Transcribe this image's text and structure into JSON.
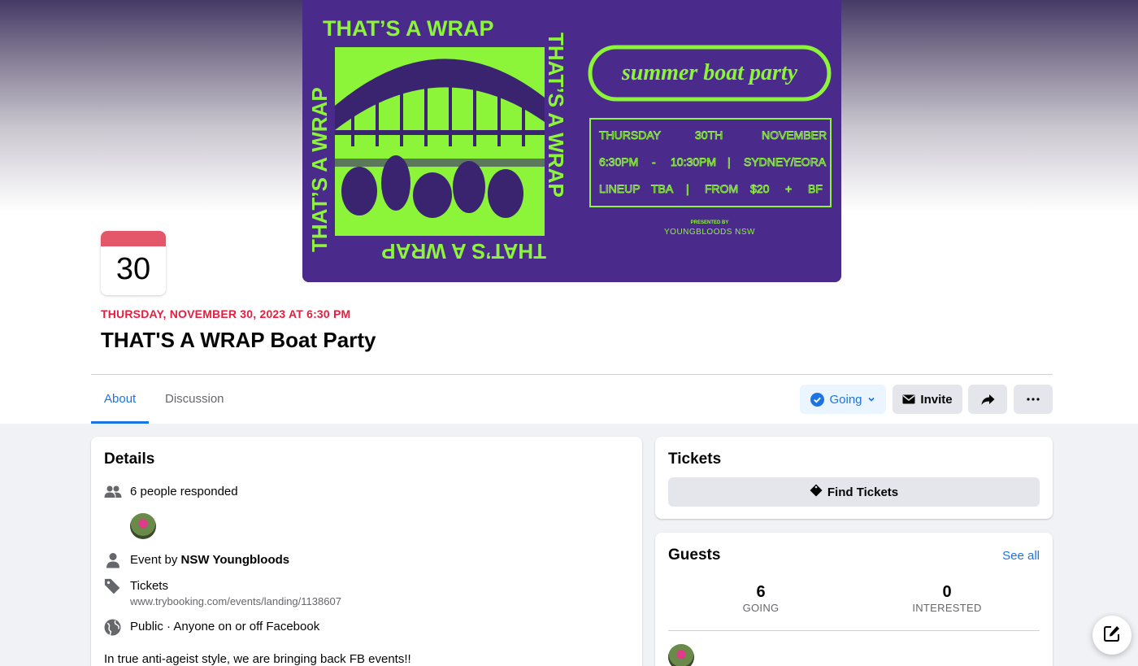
{
  "event": {
    "calendar_day": "30",
    "date_time": "THURSDAY, NOVEMBER 30, 2023 AT 6:30 PM",
    "title": "THAT'S A WRAP Boat Party"
  },
  "poster": {
    "headline": "THAT’S A WRAP",
    "pill_text": "summer boat party",
    "info_row1": [
      "THURSDAY",
      "30TH",
      "NOVEMBER"
    ],
    "info_row2": [
      "6:30PM",
      "-",
      "10:30PM",
      "|",
      "SYDNEY/EORA"
    ],
    "info_row3": [
      "LINEUP",
      "TBA",
      "|",
      "FROM",
      "$20",
      "+",
      "BF"
    ],
    "presented_by": "PRESENTED BY",
    "presenter": "YOUNGBLOODS NSW"
  },
  "tabs": [
    {
      "label": "About",
      "active": true
    },
    {
      "label": "Discussion",
      "active": false
    }
  ],
  "actions": {
    "going_label": "Going",
    "invite_label": "Invite"
  },
  "details": {
    "title": "Details",
    "responded": "6 people responded",
    "event_by_prefix": "Event by ",
    "organizer": "NSW Youngbloods",
    "tickets_label": "Tickets",
    "tickets_url": "www.trybooking.com/events/landing/1138607",
    "privacy": "Public · Anyone on or off Facebook",
    "description": "In true anti-ageist style, we are bringing back FB events!!"
  },
  "tickets": {
    "title": "Tickets",
    "find_label": "Find Tickets"
  },
  "guests": {
    "title": "Guests",
    "see_all": "See all",
    "going_count": "6",
    "going_label": "GOING",
    "interested_count": "0",
    "interested_label": "INTERESTED"
  },
  "colors": {
    "accent": "#1b74e4",
    "date_red": "#e41e3f",
    "poster_purple": "#4a2a8a",
    "poster_green": "#8cf53a"
  },
  "icons": [
    "people-icon",
    "person-icon",
    "ticket-icon",
    "globe-icon",
    "check-circle-icon",
    "chevron-down-icon",
    "envelope-icon",
    "share-icon",
    "more-icon",
    "compose-icon"
  ]
}
